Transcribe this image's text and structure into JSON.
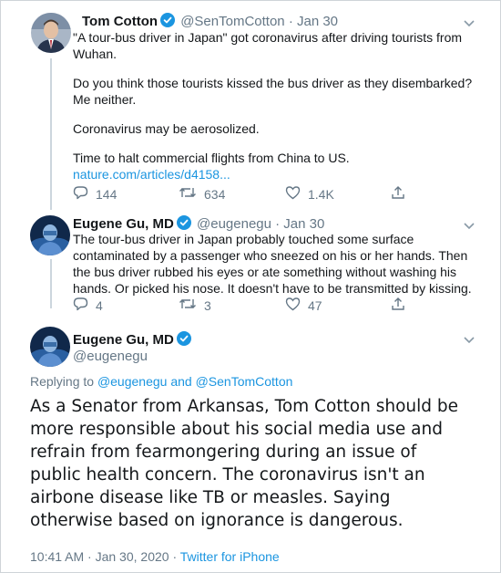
{
  "tweet1": {
    "name": "Tom Cotton",
    "meta": "@SenTomCotton · Jan 30",
    "lines": [
      "\"A tour-bus driver in Japan\" got coronavirus after driving tourists from",
      "Wuhan.",
      "",
      "Do you think those tourists kissed the bus driver as they disembarked?",
      "Me neither.",
      "",
      "Coronavirus may be aerosolized.",
      "",
      "Time to halt commercial flights from China to US."
    ],
    "link": "nature.com/articles/d4158...",
    "replies": "144",
    "retweets": "634",
    "likes": "1.4K"
  },
  "tweet2": {
    "name": "Eugene Gu, MD",
    "meta": "@eugenegu · Jan 30",
    "lines": [
      "The tour-bus driver in Japan probably touched some surface",
      "contaminated by a passenger who sneezed on his or her hands. Then",
      "the bus driver rubbed his eyes or ate something without washing his",
      "hands. Or picked his nose. It doesn't have to be transmitted by kissing."
    ],
    "replies": "4",
    "retweets": "3",
    "likes": "47"
  },
  "tweet3": {
    "name": "Eugene Gu, MD",
    "handle": "@eugenegu",
    "replying_prefix": "Replying to",
    "replying_to": "@eugenegu and @SenTomCotton",
    "lines": [
      "As a Senator from Arkansas, Tom Cotton should be",
      "more responsible about his social media use and",
      "refrain from fearmongering during an issue of",
      "public health concern. The coronavirus isn't an",
      "airbone disease like TB or measles. Saying",
      "otherwise based on ignorance is dangerous."
    ],
    "timestamp": "10:41 AM · Jan 30, 2020 ·",
    "source": "Twitter for iPhone"
  },
  "colors": {
    "accent": "#1b95e0",
    "muted": "#657786",
    "text": "#14171a"
  },
  "icons": [
    "reply-icon",
    "retweet-icon",
    "like-icon",
    "share-icon",
    "verified-badge-icon",
    "chevron-down-icon"
  ]
}
